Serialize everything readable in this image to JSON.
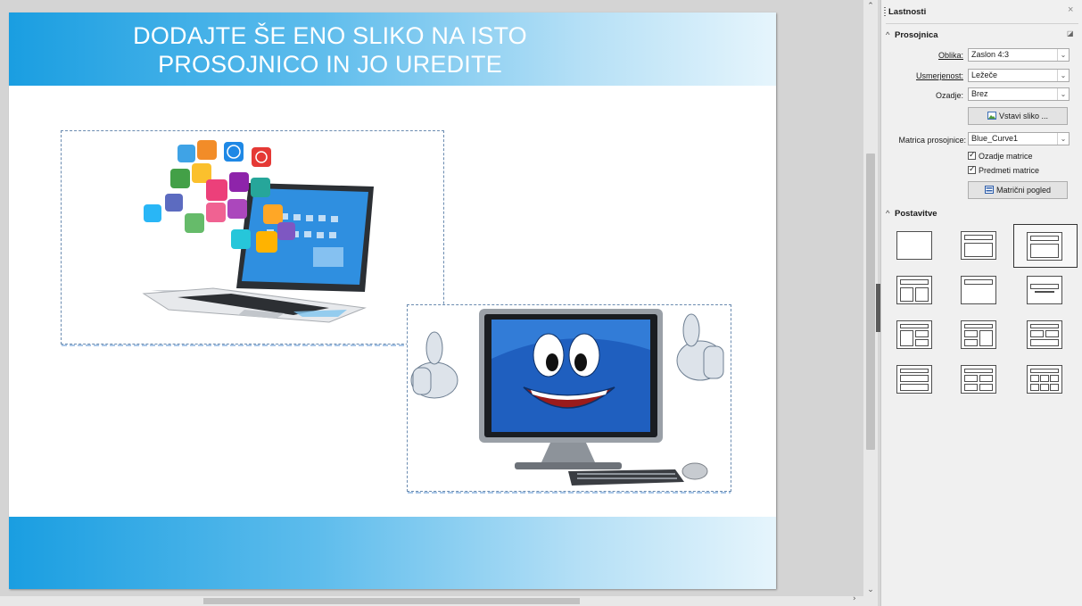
{
  "slide": {
    "title": "DODAJTE ŠE ENO SLIKO NA ISTO\nPROSOJNICO IN JO UREDITE",
    "band_colors": [
      "#1a9ee1",
      "#e6f5fc"
    ],
    "images": [
      {
        "name": "laptop-with-app-icons-image",
        "icon": "laptop-apps-illustration"
      },
      {
        "name": "happy-computer-image",
        "icon": "smiling-monitor-illustration"
      }
    ]
  },
  "sidebar": {
    "title": "Lastnosti",
    "close_icon": "×",
    "prosojnica": {
      "heading": "Prosojnica",
      "oblika_label": "Oblika:",
      "oblika_value": "Zaslon 4:3",
      "usmerjenost_label": "Usmerjenost:",
      "usmerjenost_value": "Ležeče",
      "ozadje_label": "Ozadje:",
      "ozadje_value": "Brez",
      "insert_image_button": "Vstavi sliko ...",
      "matrica_label": "Matrica prosojnice:",
      "matrica_value": "Blue_Curve1",
      "ozadje_matrice": "Ozadje matrice",
      "predmeti_matrice": "Predmeti matrice",
      "master_view_button": "Matrični pogled"
    },
    "postavitve": {
      "heading": "Postavitve",
      "selected_index": 2
    }
  }
}
